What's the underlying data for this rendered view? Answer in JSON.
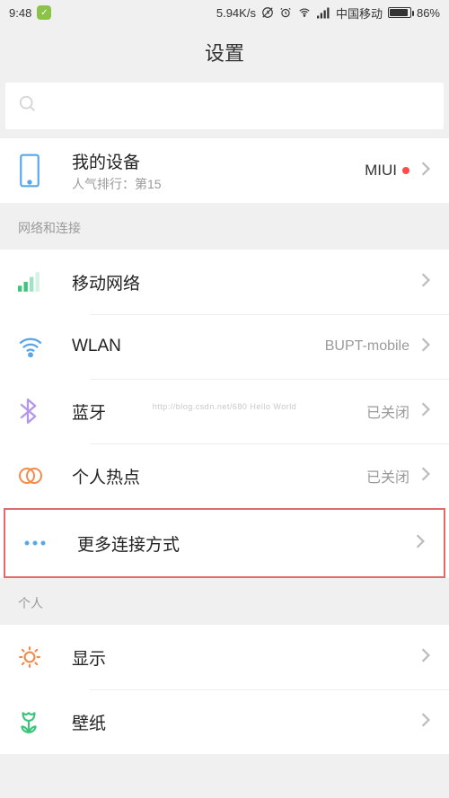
{
  "status": {
    "time": "9:48",
    "speed": "5.94K/s",
    "carrier": "中国移动",
    "battery": "86%"
  },
  "header": {
    "title": "设置"
  },
  "device": {
    "title": "我的设备",
    "sub": "人气排行：第15",
    "value": "MIUI"
  },
  "sections": {
    "network_title": "网络和连接",
    "personal_title": "个人"
  },
  "network": {
    "mobile": {
      "label": "移动网络"
    },
    "wlan": {
      "label": "WLAN",
      "value": "BUPT-mobile"
    },
    "bt": {
      "label": "蓝牙",
      "value": "已关闭"
    },
    "hotspot": {
      "label": "个人热点",
      "value": "已关闭"
    },
    "more": {
      "label": "更多连接方式"
    }
  },
  "personal": {
    "display": {
      "label": "显示"
    },
    "wallpaper": {
      "label": "壁纸"
    }
  },
  "watermark": "http://blog.csdn.net/680 Hello World"
}
